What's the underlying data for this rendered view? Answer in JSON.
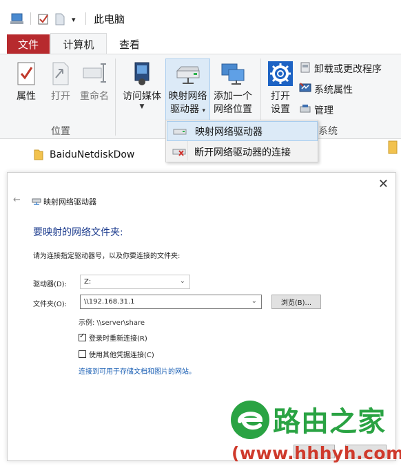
{
  "window": {
    "title": "此电脑"
  },
  "tabs": [
    {
      "label": "文件"
    },
    {
      "label": "计算机"
    },
    {
      "label": "查看"
    }
  ],
  "ribbon": {
    "location_group": {
      "label": "位置",
      "properties": "属性",
      "open": "打开",
      "rename": "重命名"
    },
    "network_group": {
      "access_media": "访问媒体",
      "map_drive_line1": "映射网络",
      "map_drive_line2": "驱动器",
      "add_location_line1": "添加一个",
      "add_location_line2": "网络位置"
    },
    "system_group": {
      "label": "系统",
      "open_settings_line1": "打开",
      "open_settings_line2": "设置",
      "uninstall": "卸载或更改程序",
      "system_properties": "系统属性",
      "manage": "管理"
    }
  },
  "dropdown": {
    "items": [
      {
        "label": "映射网络驱动器"
      },
      {
        "label": "断开网络驱动器的连接"
      }
    ]
  },
  "files": {
    "folder_name": "BaiduNetdiskDow"
  },
  "dialog": {
    "title": "映射网络驱动器",
    "heading": "要映射的网络文件夹:",
    "instruction": "请为连接指定驱动器号，以及你要连接的文件夹:",
    "drive_label": "驱动器(D):",
    "drive_value": "Z:",
    "folder_label": "文件夹(O):",
    "folder_value": "\\\\192.168.31.1",
    "browse_label": "浏览(B)...",
    "example": "示例: \\\\server\\share",
    "reconnect_label": "登录时重新连接(R)",
    "reconnect_checked": true,
    "other_credentials_label": "使用其他凭据连接(C)",
    "other_credentials_checked": false,
    "link_text": "连接到可用于存储文档和图片的网站。"
  },
  "watermark": {
    "brand": "路由之家",
    "url": "(www.hhhyh.com)"
  },
  "colors": {
    "file_tab": "#b72a2e",
    "ribbon_bg": "#f5f6f7",
    "highlight": "#dceaf7",
    "dialog_heading": "#1e3d8f",
    "link": "#1a5fb4",
    "watermark_green": "#2aa343",
    "watermark_red": "#cf3a2c"
  }
}
